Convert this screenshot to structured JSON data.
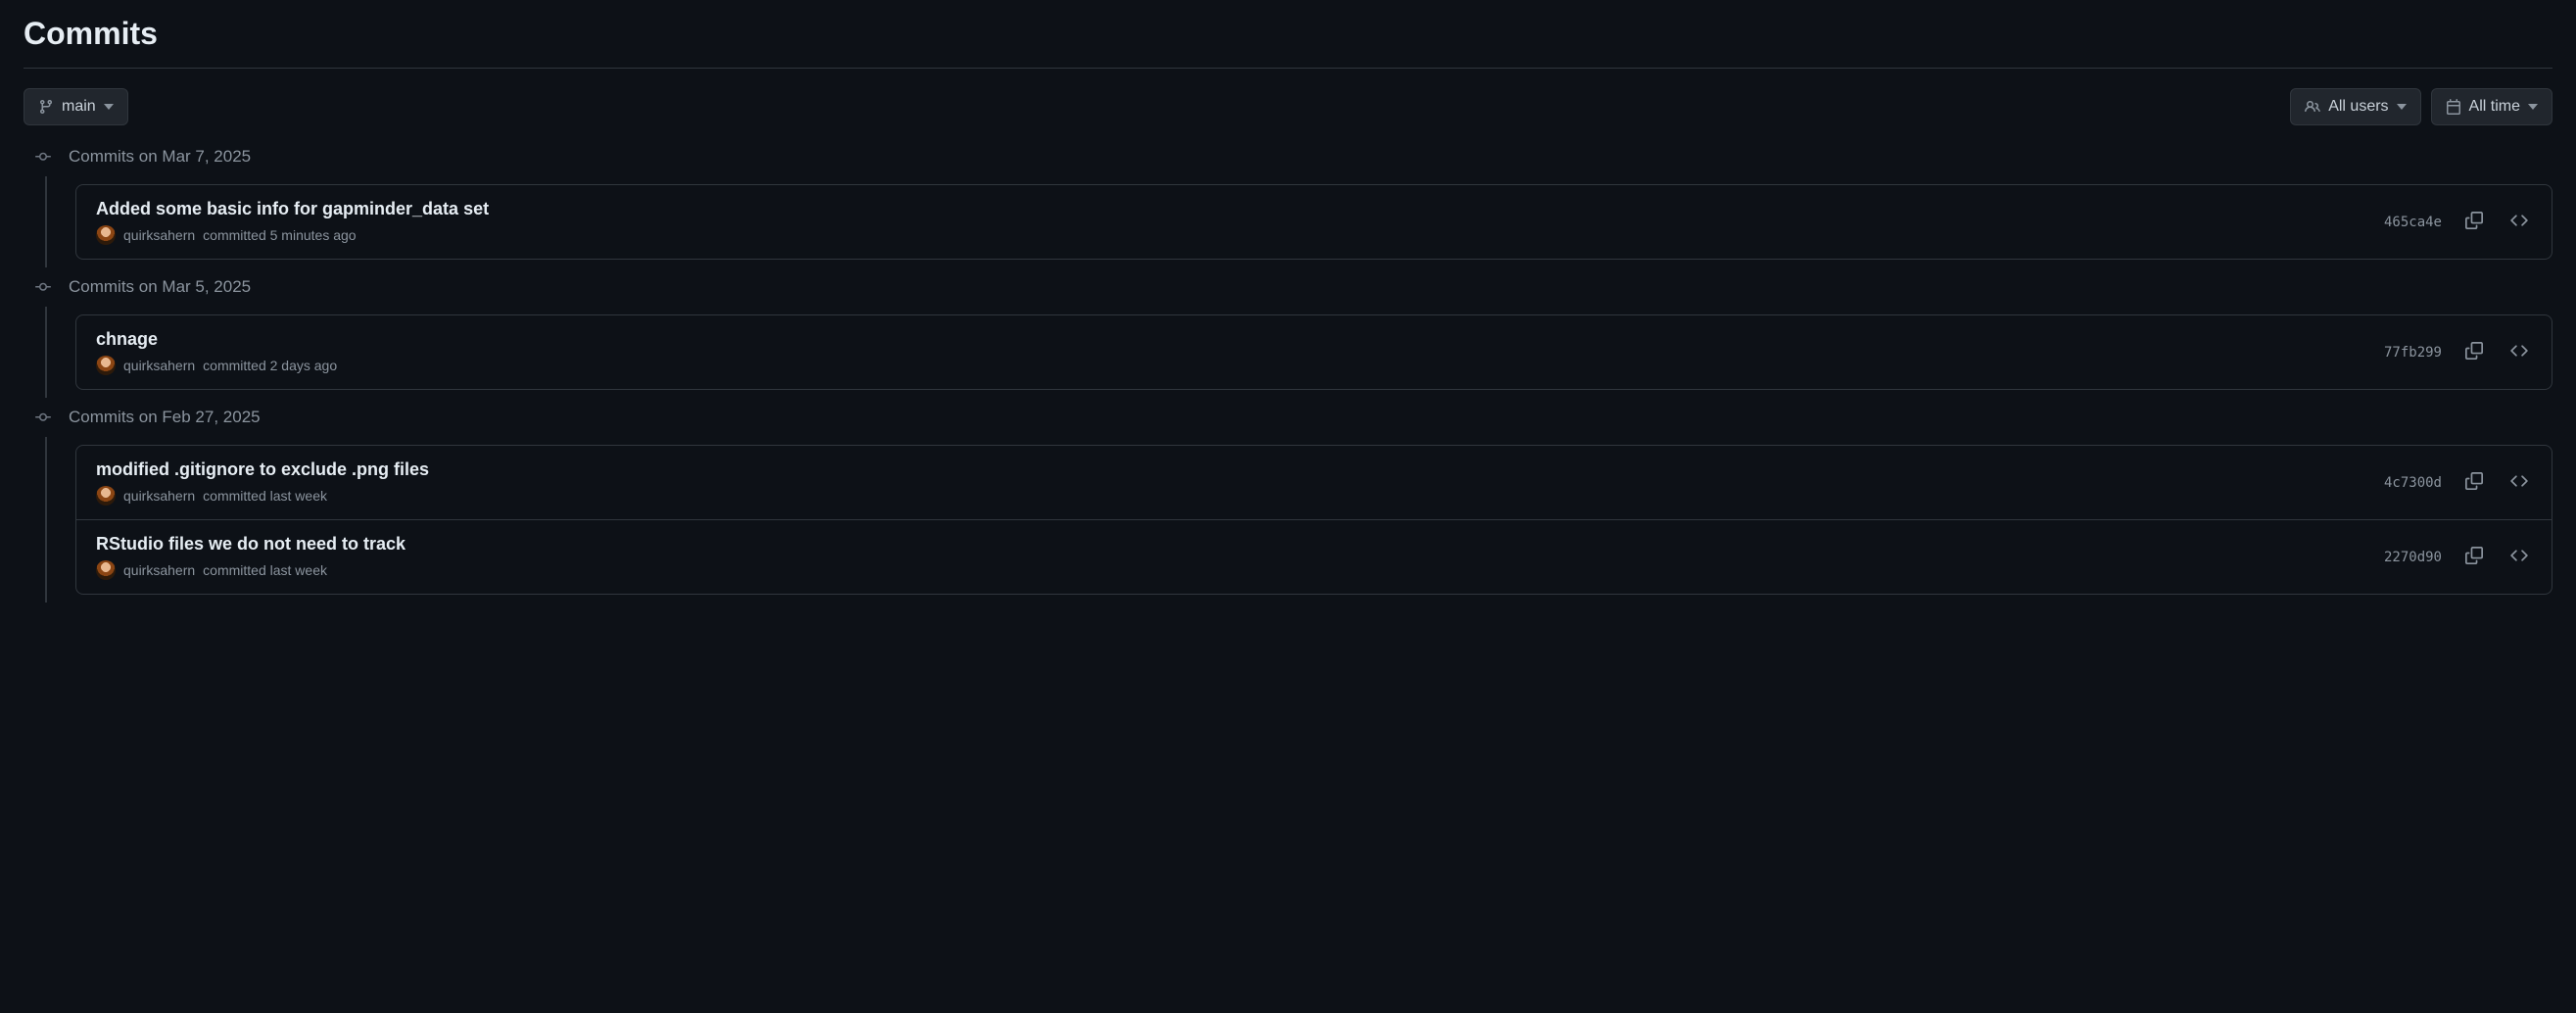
{
  "page_title": "Commits",
  "toolbar": {
    "branch_label": "main",
    "users_label": "All users",
    "time_label": "All time"
  },
  "groups": [
    {
      "date_label": "Commits on Mar 7, 2025",
      "commits": [
        {
          "title": "Added some basic info for gapminder_data set",
          "author": "quirksahern",
          "meta_text": "committed 5 minutes ago",
          "sha": "465ca4e"
        }
      ]
    },
    {
      "date_label": "Commits on Mar 5, 2025",
      "commits": [
        {
          "title": "chnage",
          "author": "quirksahern",
          "meta_text": "committed 2 days ago",
          "sha": "77fb299"
        }
      ]
    },
    {
      "date_label": "Commits on Feb 27, 2025",
      "commits": [
        {
          "title": "modified .gitignore to exclude .png files",
          "author": "quirksahern",
          "meta_text": "committed last week",
          "sha": "4c7300d"
        },
        {
          "title": "RStudio files we do not need to track",
          "author": "quirksahern",
          "meta_text": "committed last week",
          "sha": "2270d90"
        }
      ]
    }
  ]
}
